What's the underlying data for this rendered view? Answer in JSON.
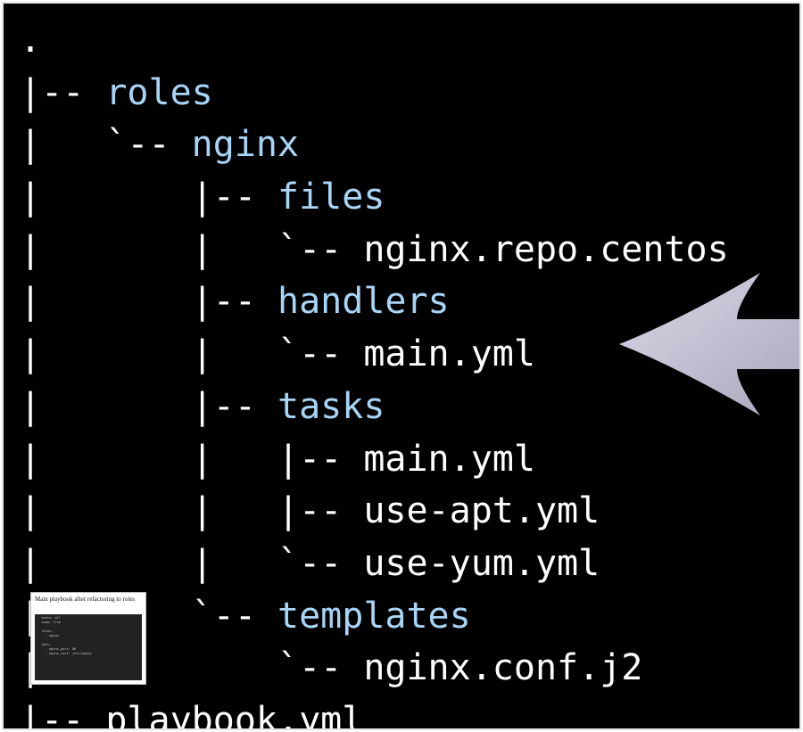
{
  "tree": {
    "lines": [
      {
        "prefix": ".",
        "name": "",
        "kind": "root"
      },
      {
        "prefix": "|-- ",
        "name": "roles",
        "kind": "dir"
      },
      {
        "prefix": "|   `-- ",
        "name": "nginx",
        "kind": "dir"
      },
      {
        "prefix": "|       |-- ",
        "name": "files",
        "kind": "dir"
      },
      {
        "prefix": "|       |   `-- ",
        "name": "nginx.repo.centos",
        "kind": "file"
      },
      {
        "prefix": "|       |-- ",
        "name": "handlers",
        "kind": "dir"
      },
      {
        "prefix": "|       |   `-- ",
        "name": "main.yml",
        "kind": "file"
      },
      {
        "prefix": "|       |-- ",
        "name": "tasks",
        "kind": "dir"
      },
      {
        "prefix": "|       |   |-- ",
        "name": "main.yml",
        "kind": "file"
      },
      {
        "prefix": "|       |   |-- ",
        "name": "use-apt.yml",
        "kind": "file"
      },
      {
        "prefix": "|       |   `-- ",
        "name": "use-yum.yml",
        "kind": "file"
      },
      {
        "prefix": "|       `-- ",
        "name": "templates",
        "kind": "dir"
      },
      {
        "prefix": "|           `-- ",
        "name": "nginx.conf.j2",
        "kind": "file"
      },
      {
        "prefix": "|-- ",
        "name": "playbook.yml",
        "kind": "file"
      }
    ]
  },
  "pointer": {
    "icon": "left-arrow-icon",
    "color": "#c6c4d6"
  },
  "thumbnail": {
    "caption": "Main playbook after refactoring to roles",
    "code": "- hosts: all\n  sudo: True\n\n  roles:\n    - nginx\n\n  vars:\n    - nginx_port: 80\n    - nginx_conf: /etc/nginx"
  },
  "colors": {
    "background": "#000000",
    "directory": "#a8d4f6",
    "file": "#ffffff"
  }
}
